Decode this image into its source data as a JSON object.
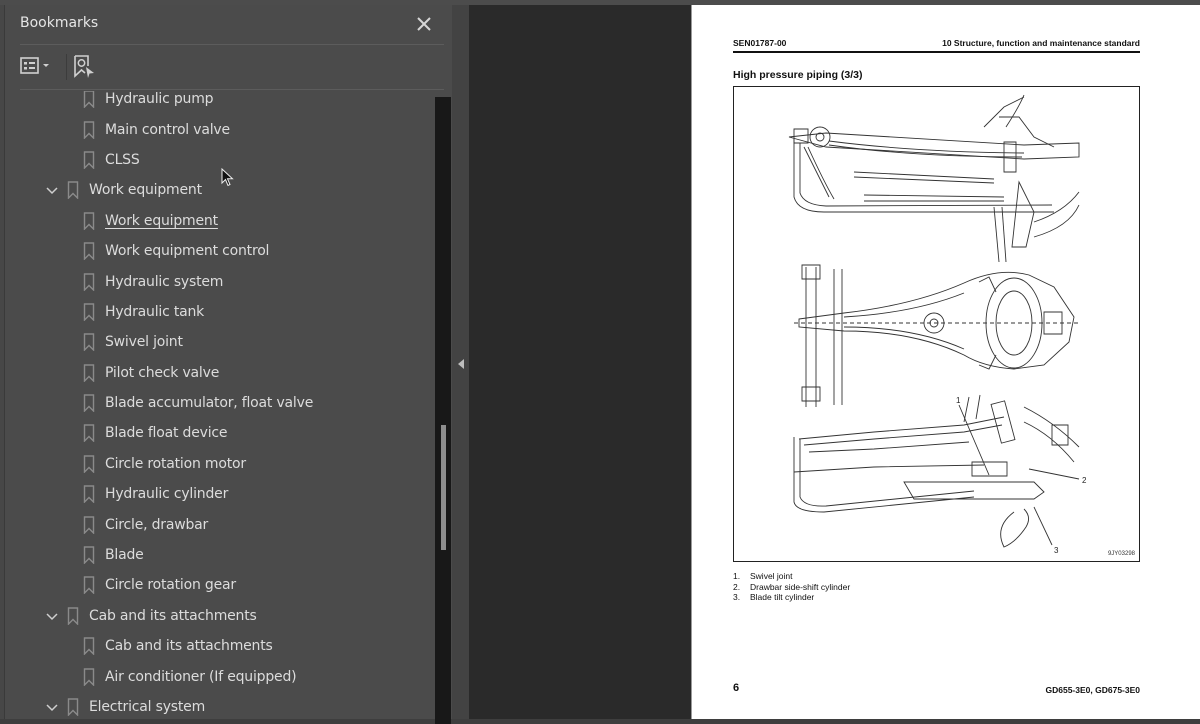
{
  "panel": {
    "title": "Bookmarks",
    "close_icon": "close-icon",
    "toolbar": {
      "options_icon": "list-options-icon",
      "find_bookmark_icon": "find-current-bookmark-icon"
    }
  },
  "bookmarks": [
    {
      "label": "Hydraulic pump",
      "level": 2,
      "expanded": null,
      "current": false
    },
    {
      "label": "Main control valve",
      "level": 2,
      "expanded": null,
      "current": false
    },
    {
      "label": "CLSS",
      "level": 2,
      "expanded": null,
      "current": false
    },
    {
      "label": "Work equipment",
      "level": 1,
      "expanded": true,
      "current": false
    },
    {
      "label": "Work equipment",
      "level": 2,
      "expanded": null,
      "current": true
    },
    {
      "label": "Work equipment control",
      "level": 2,
      "expanded": null,
      "current": false
    },
    {
      "label": "Hydraulic system",
      "level": 2,
      "expanded": null,
      "current": false
    },
    {
      "label": "Hydraulic tank",
      "level": 2,
      "expanded": null,
      "current": false
    },
    {
      "label": "Swivel joint",
      "level": 2,
      "expanded": null,
      "current": false
    },
    {
      "label": "Pilot check valve",
      "level": 2,
      "expanded": null,
      "current": false
    },
    {
      "label": "Blade accumulator, float valve",
      "level": 2,
      "expanded": null,
      "current": false
    },
    {
      "label": "Blade float device",
      "level": 2,
      "expanded": null,
      "current": false
    },
    {
      "label": "Circle rotation motor",
      "level": 2,
      "expanded": null,
      "current": false
    },
    {
      "label": "Hydraulic cylinder",
      "level": 2,
      "expanded": null,
      "current": false
    },
    {
      "label": "Circle, drawbar",
      "level": 2,
      "expanded": null,
      "current": false
    },
    {
      "label": "Blade",
      "level": 2,
      "expanded": null,
      "current": false
    },
    {
      "label": "Circle rotation gear",
      "level": 2,
      "expanded": null,
      "current": false
    },
    {
      "label": "Cab and its attachments",
      "level": 1,
      "expanded": true,
      "current": false
    },
    {
      "label": "Cab and its attachments",
      "level": 2,
      "expanded": null,
      "current": false
    },
    {
      "label": "Air conditioner (If equipped)",
      "level": 2,
      "expanded": null,
      "current": false
    },
    {
      "label": "Electrical system",
      "level": 1,
      "expanded": true,
      "current": false
    }
  ],
  "scrollbar": {
    "position_fraction": 0.52,
    "visible_fraction": 0.2
  },
  "document": {
    "header_left": "SEN01787-00",
    "header_right": "10 Structure, function and maintenance standard",
    "section_title": "High pressure piping (3/3)",
    "figure_id": "9JY03298",
    "callouts": [
      "1",
      "2",
      "3"
    ],
    "legend": [
      {
        "num": "1.",
        "text": "Swivel joint"
      },
      {
        "num": "2.",
        "text": "Drawbar side-shift cylinder"
      },
      {
        "num": "3.",
        "text": "Blade tilt cylinder"
      }
    ],
    "page_number": "6",
    "footer_right": "GD655-3E0, GD675-3E0"
  },
  "colors": {
    "panel_bg": "#4b4b4b",
    "viewer_bg": "#2a2a2a",
    "text": "#dcdcdc",
    "icon": "#8a8a8a"
  }
}
